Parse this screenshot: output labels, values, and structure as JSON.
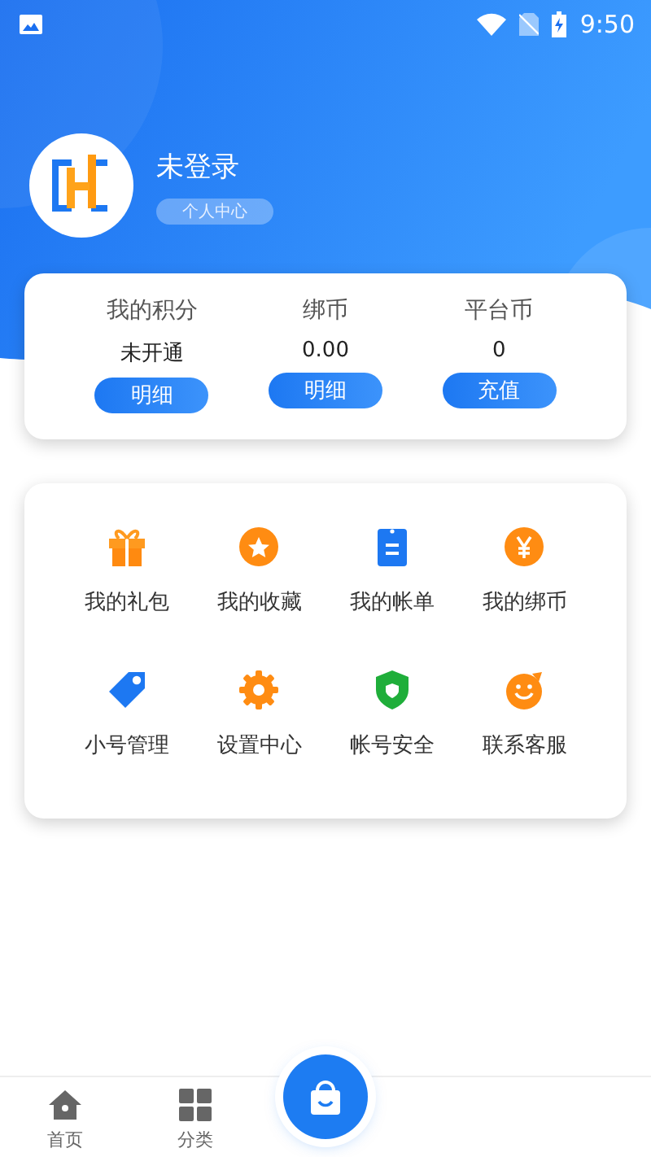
{
  "status_bar": {
    "time": "9:50"
  },
  "profile": {
    "name": "未登录",
    "link": "个人中心"
  },
  "balances": [
    {
      "label": "我的积分",
      "value": "未开通",
      "action": "明细"
    },
    {
      "label": "绑币",
      "value": "0.00",
      "action": "明细"
    },
    {
      "label": "平台币",
      "value": "0",
      "action": "充值"
    }
  ],
  "menu": [
    {
      "kind": "gift",
      "label": "我的礼包"
    },
    {
      "kind": "star",
      "label": "我的收藏"
    },
    {
      "kind": "bill",
      "label": "我的帐单"
    },
    {
      "kind": "yen",
      "label": "我的绑币"
    },
    {
      "kind": "tag",
      "label": "小号管理"
    },
    {
      "kind": "gear",
      "label": "设置中心"
    },
    {
      "kind": "shield",
      "label": "帐号安全"
    },
    {
      "kind": "smile",
      "label": "联系客服"
    }
  ],
  "tab_bar": [
    {
      "kind": "home",
      "label": "首页"
    },
    {
      "kind": "grid",
      "label": "分类"
    }
  ]
}
